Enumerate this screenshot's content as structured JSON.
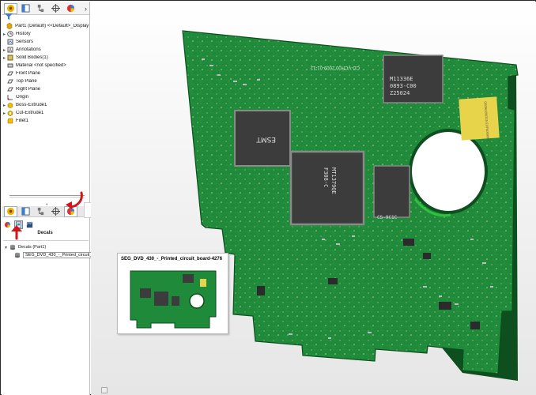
{
  "feature_tree": {
    "root_label": "Part1 (Default) <<Default>_Display State",
    "items": [
      {
        "label": "History",
        "icon": "history-icon",
        "expand": "▸"
      },
      {
        "label": "Sensors",
        "icon": "sensors-icon",
        "expand": ""
      },
      {
        "label": "Annotations",
        "icon": "annotations-icon",
        "expand": "▸"
      },
      {
        "label": "Solid Bodies(1)",
        "icon": "solid-bodies-icon",
        "expand": "▸"
      },
      {
        "label": "Material <not specified>",
        "icon": "material-icon",
        "expand": ""
      },
      {
        "label": "Front Plane",
        "icon": "plane-icon",
        "expand": ""
      },
      {
        "label": "Top Plane",
        "icon": "plane-icon",
        "expand": ""
      },
      {
        "label": "Right Plane",
        "icon": "plane-icon",
        "expand": ""
      },
      {
        "label": "Origin",
        "icon": "origin-icon",
        "expand": ""
      },
      {
        "label": "Boss-Extrude1",
        "icon": "boss-extrude-icon",
        "expand": "▸"
      },
      {
        "label": "Cut-Extrude1",
        "icon": "cut-extrude-icon",
        "expand": "▸"
      },
      {
        "label": "Fillet1",
        "icon": "fillet-icon",
        "expand": ""
      }
    ]
  },
  "tabs": {
    "more_glyph": "›",
    "names": [
      "feature-manager-tab",
      "property-manager-tab",
      "configuration-manager-tab",
      "dimxpert-tab",
      "display-manager-tab"
    ]
  },
  "decals_panel": {
    "title": "Decals",
    "group_label": "Decals (Part1)",
    "decal_label": "SEG_DVD_430_-_Printed_circuit_board-4276"
  },
  "tooltip": {
    "title": "SEG_DVD_430_-_Printed_circuit_board-4276"
  },
  "board": {
    "chip_top_right": [
      "M11336E",
      "0893-C00",
      "Z25024"
    ],
    "chip_left": "ESMT",
    "chip_center": [
      "MT1379QE",
      "F308-C"
    ],
    "chip_small": "CS-9C1C",
    "silk_top": "CD-VCR00 2009-01-12",
    "yellow_label": "DB350290215 EUFA0066M"
  },
  "colors": {
    "pcb_green": "#1f8a3a",
    "pcb_dark": "#166b2c",
    "pcb_edge": "#0d4f1e",
    "annotation_red": "#d0161b",
    "chip": "#3c3c3c",
    "label_yellow": "#e8d44a"
  }
}
